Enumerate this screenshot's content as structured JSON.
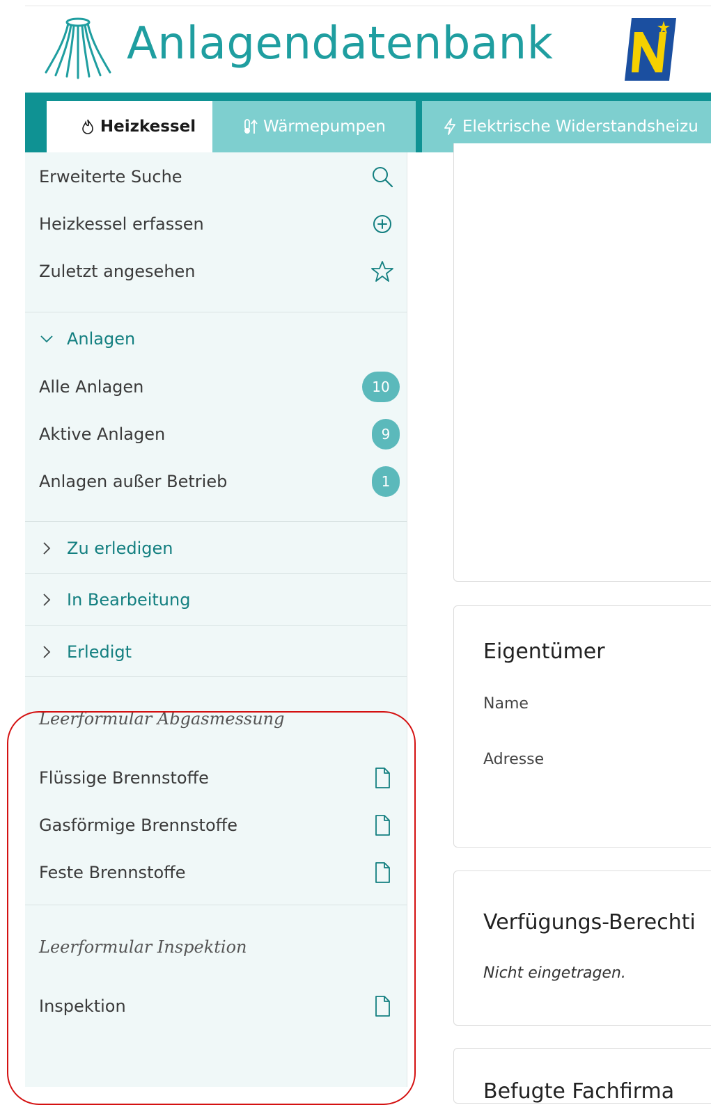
{
  "header": {
    "app_title": "Anlagendatenbank"
  },
  "colors": {
    "primary_teal": "#0f9293",
    "light_teal": "#7ecfcf",
    "sidebar_bg": "#f0f8f8",
    "badge": "#5bb9bb",
    "highlight": "#d41111"
  },
  "tabs": [
    {
      "label": "Heizkessel",
      "icon": "flame-icon",
      "active": true
    },
    {
      "label": "Wärmepumpen",
      "icon": "thermometer-arrow-icon",
      "active": false
    },
    {
      "label": "Elektrische Widerstandsheizu",
      "icon": "lightning-icon",
      "active": false
    }
  ],
  "sidebar": {
    "actions": [
      {
        "label": "Erweiterte Suche",
        "icon": "search-icon"
      },
      {
        "label": "Heizkessel erfassen",
        "icon": "plus-circle-icon"
      },
      {
        "label": "Zuletzt angesehen",
        "icon": "star-icon"
      }
    ],
    "anlagen": {
      "label": "Anlagen",
      "expanded": true,
      "items": [
        {
          "label": "Alle Anlagen",
          "count": "10"
        },
        {
          "label": "Aktive Anlagen",
          "count": "9"
        },
        {
          "label": "Anlagen außer Betrieb",
          "count": "1"
        }
      ]
    },
    "sections": [
      {
        "label": "Zu erledigen"
      },
      {
        "label": "In Bearbeitung"
      },
      {
        "label": "Erledigt"
      }
    ],
    "abgas": {
      "heading": "Leerformular Abgasmessung",
      "items": [
        {
          "label": "Flüssige Brennstoffe",
          "icon": "document-icon"
        },
        {
          "label": "Gasförmige Brennstoffe",
          "icon": "document-icon"
        },
        {
          "label": "Feste Brennstoffe",
          "icon": "document-icon"
        }
      ]
    },
    "inspektion": {
      "heading": "Leerformular Inspektion",
      "items": [
        {
          "label": "Inspektion",
          "icon": "document-icon"
        }
      ]
    }
  },
  "main": {
    "owner_card": {
      "title": "Eigentümer",
      "fields": [
        "Name",
        "Adresse"
      ]
    },
    "disposal_card": {
      "title": "Verfügungs-Berechti",
      "value": "Nicht eingetragen."
    },
    "next_card": {
      "title": "Befugte Fachfirma"
    }
  }
}
